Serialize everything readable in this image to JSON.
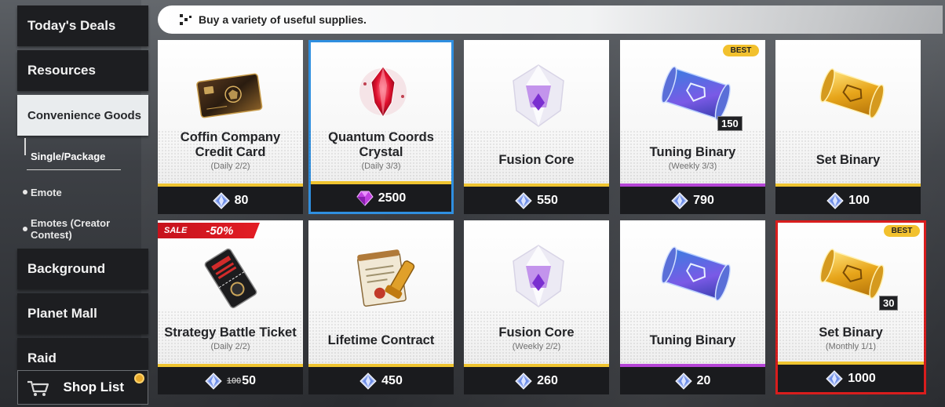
{
  "sidebar": {
    "categories": [
      {
        "label": "Today's Deals"
      },
      {
        "label": "Resources"
      },
      {
        "label": "Convenience Goods"
      },
      {
        "label": "Background"
      },
      {
        "label": "Planet Mall"
      },
      {
        "label": "Raid"
      }
    ],
    "sub_items": [
      {
        "label": "Single/Package"
      },
      {
        "label": "Emote"
      },
      {
        "label": "Emotes (Creator Contest)"
      }
    ],
    "shop_list_label": "Shop List"
  },
  "banner": {
    "text": "Buy a variety of useful supplies."
  },
  "cards": [
    {
      "name": "Coffin Company Credit Card",
      "limit": "(Daily 2/2)",
      "price": "80",
      "currency": "crystal-gem-icon"
    },
    {
      "name": "Quantum Coords Crystal",
      "limit": "(Daily 3/3)",
      "price": "2500",
      "currency": "purple-gem-icon"
    },
    {
      "name": "Fusion Core",
      "limit": "",
      "price": "550",
      "currency": "crystal-gem-icon"
    },
    {
      "name": "Tuning Binary",
      "limit": "(Weekly 3/3)",
      "price": "790",
      "currency": "crystal-gem-icon",
      "badge": "BEST",
      "quantity": "150"
    },
    {
      "name": "Set Binary",
      "limit": "",
      "price": "100",
      "currency": "crystal-gem-icon"
    },
    {
      "name": "Strategy Battle Ticket",
      "limit": "(Daily 2/2)",
      "price": "50",
      "old_price": "100",
      "currency": "crystal-gem-icon",
      "sale_label": "SALE",
      "sale_discount": "-50%"
    },
    {
      "name": "Lifetime Contract",
      "limit": "",
      "price": "450",
      "currency": "crystal-gem-icon"
    },
    {
      "name": "Fusion Core",
      "limit": "(Weekly 2/2)",
      "price": "260",
      "currency": "crystal-gem-icon"
    },
    {
      "name": "Tuning Binary",
      "limit": "",
      "price": "20",
      "currency": "crystal-gem-icon"
    },
    {
      "name": "Set Binary",
      "limit": "(Monthly 1/1)",
      "price": "1000",
      "currency": "crystal-gem-icon",
      "badge": "BEST",
      "quantity": "30"
    }
  ],
  "colors": {
    "gold_stripe": "#efc430",
    "purple_stripe": "#b545d6",
    "selected_border": "#2f8fe0",
    "highlight_border": "#d91d1d",
    "best_badge": "#f2c12e",
    "sale_badge": "#e31d24"
  }
}
